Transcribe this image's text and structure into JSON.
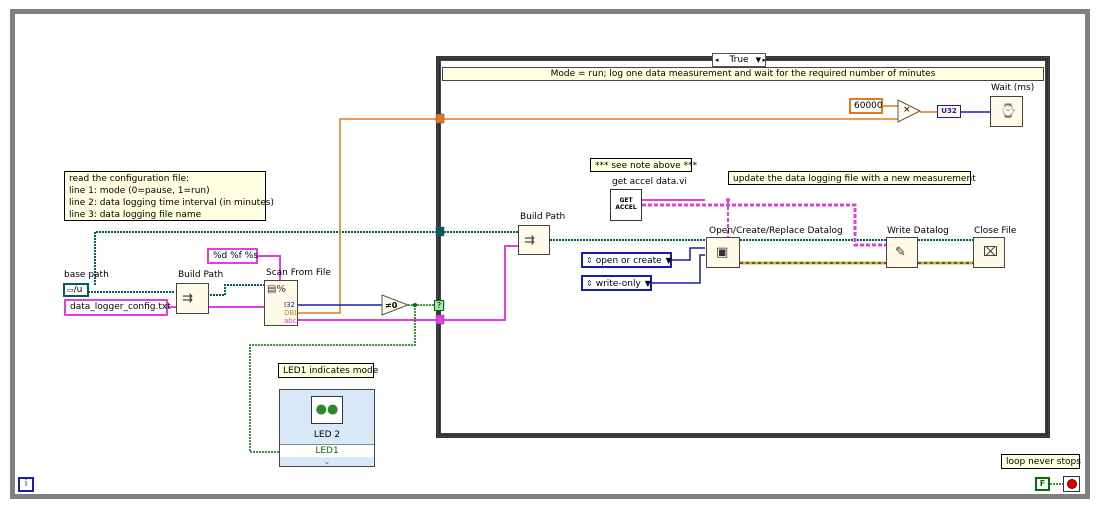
{
  "diagram": {
    "case_selector": "True",
    "case_comment": "Mode = run; log one data measurement and wait for the required number of minutes",
    "config_note": [
      "read the configuration file:",
      "line 1: mode (0=pause, 1=run)",
      "line 2: data logging time interval (in minutes)",
      "line 3: data logging file name"
    ],
    "base_path_label": "base path",
    "base_path_value": "/u",
    "filename_value": "data_logger_config.txt",
    "format_string": "%d %f %s",
    "build_path_label": "Build Path",
    "build_path_label_2": "Build Path",
    "scan_label": "Scan From File",
    "scan_outputs": [
      "I32",
      "DBL",
      "abc"
    ],
    "not_equal_glyph": "≠0",
    "led_note": "LED1 indicates mode",
    "led_node_title": "LED 2",
    "led_node_item": "LED1",
    "see_note": "*** see note above ***",
    "get_accel_label": "get accel data.vi",
    "get_accel_icon": [
      "GET",
      "ACCEL"
    ],
    "update_note": "update the data logging file with a new measurement",
    "open_label": "Open/Create/Replace Datalog",
    "open_mode": "open or create",
    "access_mode": "write-only",
    "write_label": "Write Datalog",
    "close_label": "Close File",
    "wait_label": "Wait (ms)",
    "wait_const": "60000",
    "u32_label": "U32",
    "multiply_glyph": "×",
    "loop_note": "loop never stops",
    "stop_const": "F",
    "iteration_label": "i",
    "question_mark": "?"
  },
  "colors": {
    "frame": "#808080",
    "integer_wire": "#1a1ab0",
    "float_wire": "#e07a1a",
    "string_wire": "#e040e0",
    "refnum_wire": "#006060",
    "error_wire": "#c8b040",
    "boolean_wire": "#007000",
    "note_bg": "#ffffe1"
  }
}
